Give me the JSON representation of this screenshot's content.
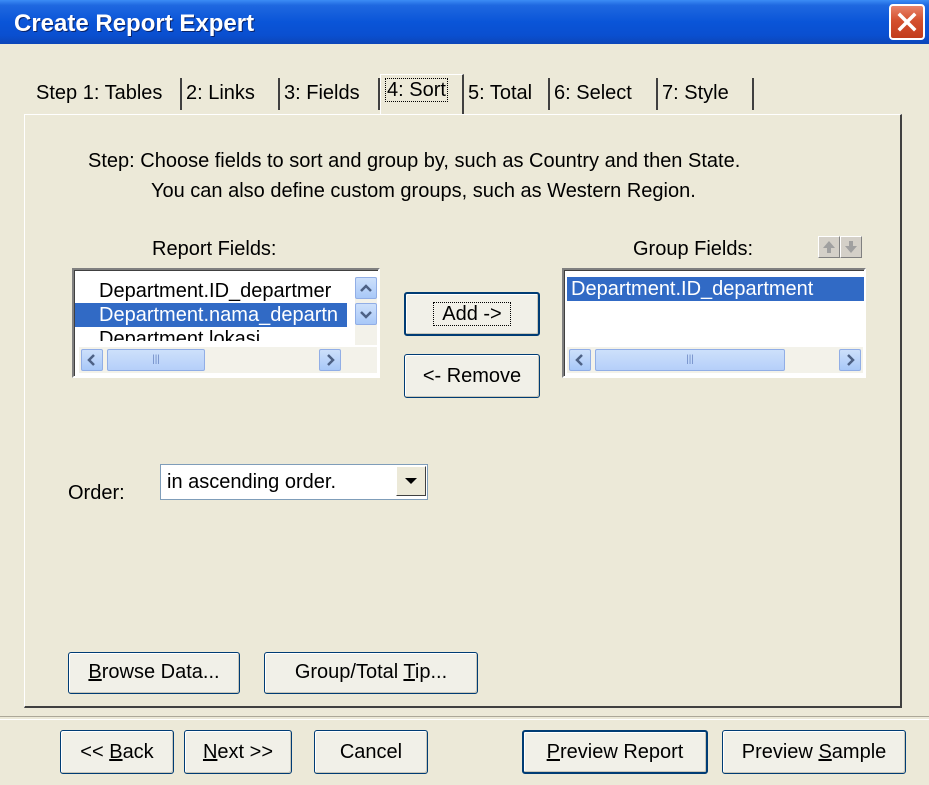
{
  "window": {
    "title": "Create Report Expert"
  },
  "tabs": [
    {
      "label": "Step 1: Tables"
    },
    {
      "label": "2: Links"
    },
    {
      "label": "3: Fields"
    },
    {
      "label": "4: Sort"
    },
    {
      "label": "5: Total"
    },
    {
      "label": "6: Select"
    },
    {
      "label": "7: Style"
    }
  ],
  "step": {
    "line1": "Step:  Choose fields to sort and group by, such as Country and then State.",
    "line2": "You can also define custom groups, such as Western Region."
  },
  "report_fields": {
    "label": "Report Fields:",
    "items": [
      {
        "text": "Department.ID_departmer"
      },
      {
        "text": "Department.nama_departn"
      },
      {
        "text": "Department.lokasi"
      }
    ]
  },
  "group_fields": {
    "label": "Group Fields:",
    "items": [
      {
        "text": "Department.ID_department"
      }
    ]
  },
  "buttons": {
    "add": "Add ->",
    "remove": "<- Remove",
    "browse_data_pre": "B",
    "browse_data_rest": "rowse Data...",
    "group_tip_pre": "Group/Total ",
    "group_tip_u": "T",
    "group_tip_rest": "ip...",
    "back_pre": "<< ",
    "back_u": "B",
    "back_rest": "ack",
    "next_u": "N",
    "next_rest": "ext >>",
    "cancel": "Cancel",
    "preview_report_u": "P",
    "preview_report_rest": "review Report",
    "preview_sample_pre": "Preview ",
    "preview_sample_u": "S",
    "preview_sample_rest": "ample"
  },
  "order": {
    "label": "Order:",
    "value": "in ascending order."
  },
  "colors": {
    "selection": "#316ac5",
    "titlebar": "#0a55d8",
    "dialog_bg": "#ece9d8"
  }
}
